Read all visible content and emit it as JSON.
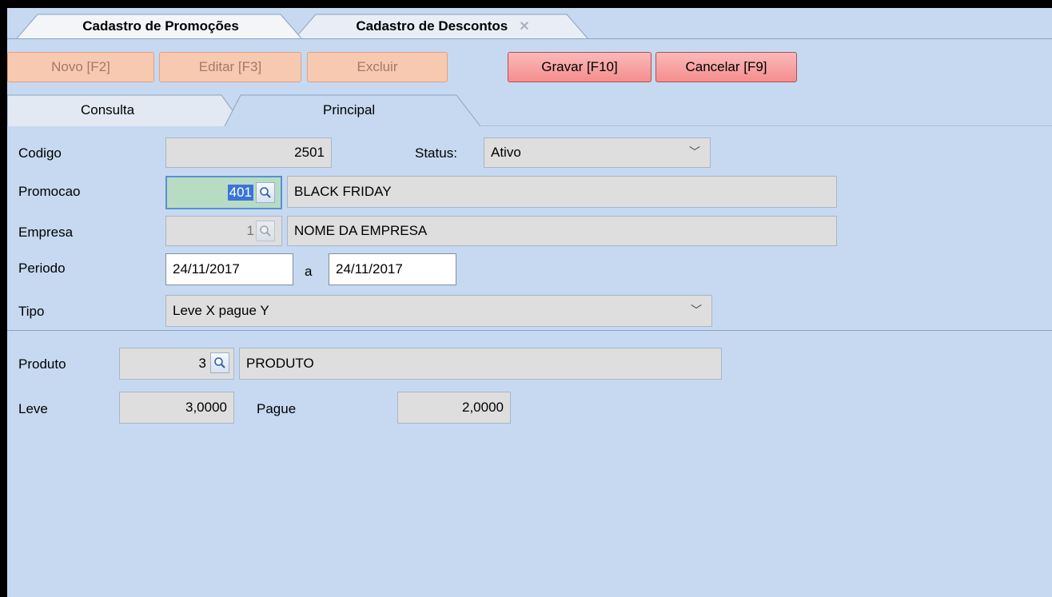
{
  "doc_tabs": {
    "tab1": "Cadastro de Promoções",
    "tab2": "Cadastro de Descontos"
  },
  "toolbar": {
    "novo": "Novo [F2]",
    "editar": "Editar [F3]",
    "excluir": "Excluir",
    "gravar": "Gravar [F10]",
    "cancelar": "Cancelar [F9]"
  },
  "page_tabs": {
    "consulta": "Consulta",
    "principal": "Principal"
  },
  "form": {
    "codigo_label": "Codigo",
    "codigo_value": "2501",
    "status_label": "Status:",
    "status_value": "Ativo",
    "promocao_label": "Promocao",
    "promocao_code": "401",
    "promocao_name": "BLACK FRIDAY",
    "empresa_label": "Empresa",
    "empresa_code": "1",
    "empresa_name": "NOME DA EMPRESA",
    "periodo_label": "Periodo",
    "periodo_start": "24/11/2017",
    "periodo_sep": "a",
    "periodo_end": "24/11/2017",
    "tipo_label": "Tipo",
    "tipo_value": "Leve X pague Y",
    "produto_label": "Produto",
    "produto_code": "3",
    "produto_name": "PRODUTO",
    "leve_label": "Leve",
    "leve_value": "3,0000",
    "pague_label": "Pague",
    "pague_value": "2,0000"
  },
  "icons": {
    "lookup": "magnifier-icon",
    "close": "close-icon",
    "dropdown": "chevron-down-icon"
  }
}
